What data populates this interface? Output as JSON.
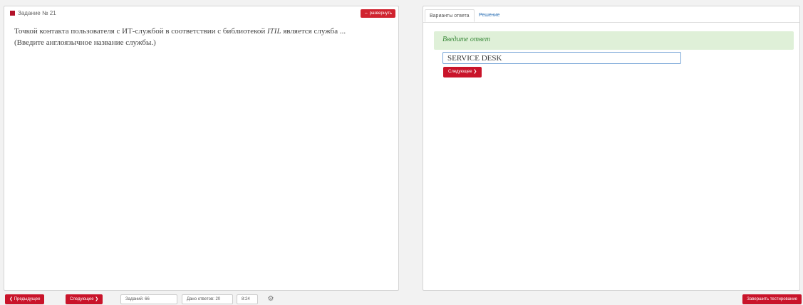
{
  "task": {
    "number_label": "Задание № 21",
    "expand_label": "⇔ развернуть"
  },
  "question": {
    "line1_pre": "Точкой контакта пользователя с ИТ-службой в соответствии с библиотекой ",
    "line1_em": "ITIL",
    "line1_post": " является служба ...",
    "line2": "(Введите англоязычное название службы.)"
  },
  "answer_panel": {
    "tab_active": "Варианты ответа",
    "tab_inactive": "Решение",
    "banner": "Введите ответ",
    "input_value": "SERVICE DESK",
    "next_label": "Следующее ❯"
  },
  "bottom_bar": {
    "prev_label": "❮ Предыдущее",
    "next_label": "Следующее ❯",
    "tasks_count": "Заданий: 66",
    "answers_given": "Дано ответов: 20",
    "timer": "8:24",
    "gear_icon": "gear-icon",
    "finish_label": "Завершить тестирование"
  },
  "colors": {
    "accent_red": "#c9142a",
    "banner_green": "#dff0d8",
    "link_blue": "#2a6fb4"
  }
}
